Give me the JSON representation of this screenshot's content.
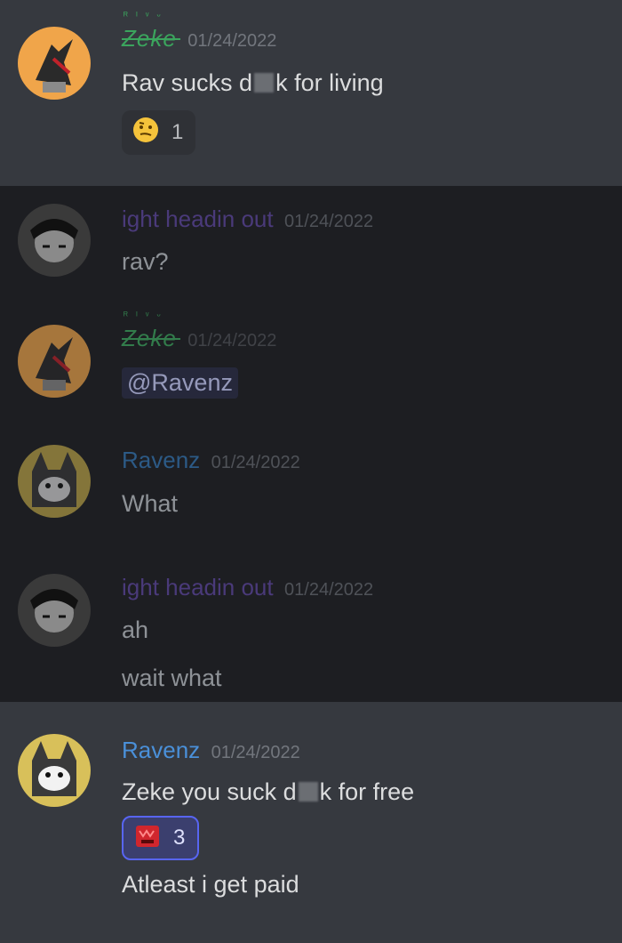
{
  "colors": {
    "zeke": "#3ba55d",
    "ight": "#4a3a7a",
    "ravenz": "#4a90d9",
    "light_bg": "#36393f",
    "dark_bg": "#1d1e22"
  },
  "messages": [
    {
      "user": "Zeke",
      "timestamp": "01/24/2022",
      "lines": [
        "Rav sucks d",
        "k for living"
      ],
      "reaction": {
        "emoji_icon": "thinking-face-icon",
        "count": "1"
      }
    },
    {
      "user": "ight headin out",
      "timestamp": "01/24/2022",
      "lines": [
        "rav?"
      ]
    },
    {
      "user": "Zeke",
      "timestamp": "01/24/2022",
      "mention": "@Ravenz"
    },
    {
      "user": "Ravenz",
      "timestamp": "01/24/2022",
      "lines": [
        "What"
      ]
    },
    {
      "user": "ight headin out",
      "timestamp": "01/24/2022",
      "lines": [
        "ah",
        "wait what"
      ]
    },
    {
      "user": "Ravenz",
      "timestamp": "01/24/2022",
      "lines": [
        "Zeke you suck d",
        "k for free",
        "Atleast i get paid"
      ],
      "reaction": {
        "emoji_icon": "red-creature-emoji-icon",
        "count": "3"
      }
    }
  ]
}
